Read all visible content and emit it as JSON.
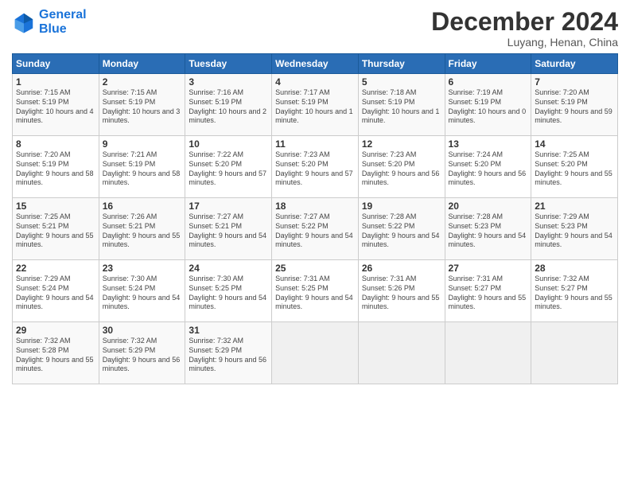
{
  "logo": {
    "line1": "General",
    "line2": "Blue"
  },
  "title": "December 2024",
  "subtitle": "Luyang, Henan, China",
  "days_of_week": [
    "Sunday",
    "Monday",
    "Tuesday",
    "Wednesday",
    "Thursday",
    "Friday",
    "Saturday"
  ],
  "weeks": [
    [
      {
        "day": "1",
        "rise": "7:15 AM",
        "set": "5:19 PM",
        "daylight": "10 hours and 4 minutes."
      },
      {
        "day": "2",
        "rise": "7:15 AM",
        "set": "5:19 PM",
        "daylight": "10 hours and 3 minutes."
      },
      {
        "day": "3",
        "rise": "7:16 AM",
        "set": "5:19 PM",
        "daylight": "10 hours and 2 minutes."
      },
      {
        "day": "4",
        "rise": "7:17 AM",
        "set": "5:19 PM",
        "daylight": "10 hours and 1 minute."
      },
      {
        "day": "5",
        "rise": "7:18 AM",
        "set": "5:19 PM",
        "daylight": "10 hours and 1 minute."
      },
      {
        "day": "6",
        "rise": "7:19 AM",
        "set": "5:19 PM",
        "daylight": "10 hours and 0 minutes."
      },
      {
        "day": "7",
        "rise": "7:20 AM",
        "set": "5:19 PM",
        "daylight": "9 hours and 59 minutes."
      }
    ],
    [
      {
        "day": "8",
        "rise": "7:20 AM",
        "set": "5:19 PM",
        "daylight": "9 hours and 58 minutes."
      },
      {
        "day": "9",
        "rise": "7:21 AM",
        "set": "5:19 PM",
        "daylight": "9 hours and 58 minutes."
      },
      {
        "day": "10",
        "rise": "7:22 AM",
        "set": "5:20 PM",
        "daylight": "9 hours and 57 minutes."
      },
      {
        "day": "11",
        "rise": "7:23 AM",
        "set": "5:20 PM",
        "daylight": "9 hours and 57 minutes."
      },
      {
        "day": "12",
        "rise": "7:23 AM",
        "set": "5:20 PM",
        "daylight": "9 hours and 56 minutes."
      },
      {
        "day": "13",
        "rise": "7:24 AM",
        "set": "5:20 PM",
        "daylight": "9 hours and 56 minutes."
      },
      {
        "day": "14",
        "rise": "7:25 AM",
        "set": "5:20 PM",
        "daylight": "9 hours and 55 minutes."
      }
    ],
    [
      {
        "day": "15",
        "rise": "7:25 AM",
        "set": "5:21 PM",
        "daylight": "9 hours and 55 minutes."
      },
      {
        "day": "16",
        "rise": "7:26 AM",
        "set": "5:21 PM",
        "daylight": "9 hours and 55 minutes."
      },
      {
        "day": "17",
        "rise": "7:27 AM",
        "set": "5:21 PM",
        "daylight": "9 hours and 54 minutes."
      },
      {
        "day": "18",
        "rise": "7:27 AM",
        "set": "5:22 PM",
        "daylight": "9 hours and 54 minutes."
      },
      {
        "day": "19",
        "rise": "7:28 AM",
        "set": "5:22 PM",
        "daylight": "9 hours and 54 minutes."
      },
      {
        "day": "20",
        "rise": "7:28 AM",
        "set": "5:23 PM",
        "daylight": "9 hours and 54 minutes."
      },
      {
        "day": "21",
        "rise": "7:29 AM",
        "set": "5:23 PM",
        "daylight": "9 hours and 54 minutes."
      }
    ],
    [
      {
        "day": "22",
        "rise": "7:29 AM",
        "set": "5:24 PM",
        "daylight": "9 hours and 54 minutes."
      },
      {
        "day": "23",
        "rise": "7:30 AM",
        "set": "5:24 PM",
        "daylight": "9 hours and 54 minutes."
      },
      {
        "day": "24",
        "rise": "7:30 AM",
        "set": "5:25 PM",
        "daylight": "9 hours and 54 minutes."
      },
      {
        "day": "25",
        "rise": "7:31 AM",
        "set": "5:25 PM",
        "daylight": "9 hours and 54 minutes."
      },
      {
        "day": "26",
        "rise": "7:31 AM",
        "set": "5:26 PM",
        "daylight": "9 hours and 55 minutes."
      },
      {
        "day": "27",
        "rise": "7:31 AM",
        "set": "5:27 PM",
        "daylight": "9 hours and 55 minutes."
      },
      {
        "day": "28",
        "rise": "7:32 AM",
        "set": "5:27 PM",
        "daylight": "9 hours and 55 minutes."
      }
    ],
    [
      {
        "day": "29",
        "rise": "7:32 AM",
        "set": "5:28 PM",
        "daylight": "9 hours and 55 minutes."
      },
      {
        "day": "30",
        "rise": "7:32 AM",
        "set": "5:29 PM",
        "daylight": "9 hours and 56 minutes."
      },
      {
        "day": "31",
        "rise": "7:32 AM",
        "set": "5:29 PM",
        "daylight": "9 hours and 56 minutes."
      },
      null,
      null,
      null,
      null
    ]
  ]
}
